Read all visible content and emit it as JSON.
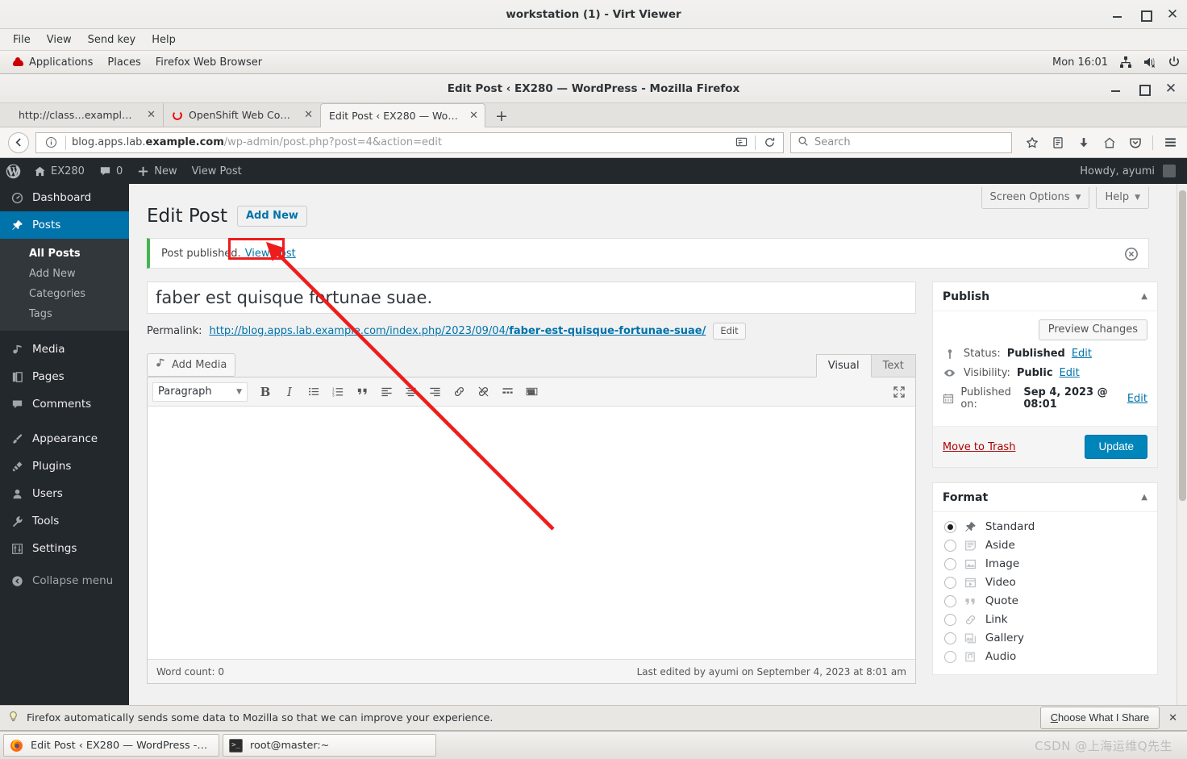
{
  "virt_viewer": {
    "title": "workstation (1) - Virt Viewer",
    "menus": [
      "File",
      "View",
      "Send key",
      "Help"
    ],
    "window_buttons": [
      "minimize",
      "maximize",
      "close"
    ]
  },
  "gnome_panel": {
    "applications": "Applications",
    "places": "Places",
    "app_name": "Firefox Web Browser",
    "clock": "Mon 16:01",
    "tray": [
      "network-icon",
      "volume-muted-icon",
      "power-icon"
    ]
  },
  "firefox": {
    "window_title": "Edit Post ‹ EX280 — WordPress - Mozilla Firefox",
    "tabs": [
      {
        "label": "http://class…example.com/",
        "active": false,
        "favicon": "none"
      },
      {
        "label": "OpenShift Web Cons…",
        "active": false,
        "favicon": "openshift-icon"
      },
      {
        "label": "Edit Post ‹ EX280 — Wor…",
        "active": true,
        "favicon": "none"
      }
    ],
    "new_tab_label": "+",
    "url": {
      "prefix": "blog.apps.lab.",
      "domain": "example.com",
      "path": "/wp-admin/post.php?post=4&action=edit"
    },
    "search_placeholder": "Search",
    "toolbar_icons": [
      "reader-mode-icon",
      "reload-icon",
      "bookmark-star-icon",
      "library-icon",
      "downloads-icon",
      "home-icon",
      "pocket-icon",
      "hamburger-menu-icon"
    ],
    "notification": {
      "text": "Firefox automatically sends some data to Mozilla so that we can improve your experience.",
      "button": "Choose What I Share",
      "close": "✕"
    }
  },
  "wp_adminbar": {
    "site_name": "EX280",
    "comments_count": "0",
    "new_label": "New",
    "view_post_label": "View Post",
    "howdy": "Howdy, ayumi"
  },
  "sidebar": {
    "items": [
      {
        "label": "Dashboard",
        "icon": "dashboard-icon",
        "current": false
      },
      {
        "label": "Posts",
        "icon": "pin-icon",
        "current": true
      },
      {
        "label": "Media",
        "icon": "media-icon",
        "current": false
      },
      {
        "label": "Pages",
        "icon": "pages-icon",
        "current": false
      },
      {
        "label": "Comments",
        "icon": "comments-icon",
        "current": false
      },
      {
        "label": "Appearance",
        "icon": "brush-icon",
        "current": false
      },
      {
        "label": "Plugins",
        "icon": "plugin-icon",
        "current": false
      },
      {
        "label": "Users",
        "icon": "user-icon",
        "current": false
      },
      {
        "label": "Tools",
        "icon": "wrench-icon",
        "current": false
      },
      {
        "label": "Settings",
        "icon": "settings-icon",
        "current": false
      }
    ],
    "submenu": [
      {
        "label": "All Posts",
        "active": true
      },
      {
        "label": "Add New",
        "active": false
      },
      {
        "label": "Categories",
        "active": false
      },
      {
        "label": "Tags",
        "active": false
      }
    ],
    "collapse_label": "Collapse menu"
  },
  "screen_meta": {
    "screen_options": "Screen Options",
    "help": "Help"
  },
  "page": {
    "title": "Edit Post",
    "add_new": "Add New",
    "notice_text": "Post published.",
    "notice_link": "View post"
  },
  "editor": {
    "post_title": "faber est quisque fortunae suae.",
    "permalink_label": "Permalink:",
    "permalink_prefix": "http://blog.apps.lab.example.com/index.php/2023/09/04/",
    "permalink_slug": "faber-est-quisque-fortunae-suae/",
    "permalink_edit": "Edit",
    "add_media": "Add Media",
    "tabs": [
      {
        "label": "Visual",
        "active": true
      },
      {
        "label": "Text",
        "active": false
      }
    ],
    "format_select": "Paragraph",
    "toolbar_buttons": [
      "bold-icon",
      "italic-icon",
      "bulleted-list-icon",
      "numbered-list-icon",
      "blockquote-icon",
      "align-left-icon",
      "align-center-icon",
      "align-right-icon",
      "insert-link-icon",
      "remove-link-icon",
      "read-more-icon",
      "toolbar-toggle-icon"
    ],
    "fullscreen_icon": "fullscreen-icon",
    "content": "",
    "word_count": "Word count: 0",
    "last_edited": "Last edited by ayumi on September 4, 2023 at 8:01 am"
  },
  "publish_box": {
    "title": "Publish",
    "preview_changes": "Preview Changes",
    "status_label": "Status:",
    "status_value": "Published",
    "status_edit": "Edit",
    "visibility_label": "Visibility:",
    "visibility_value": "Public",
    "visibility_edit": "Edit",
    "published_label": "Published on:",
    "published_value": "Sep 4, 2023 @ 08:01",
    "published_edit": "Edit",
    "move_to_trash": "Move to Trash",
    "update": "Update"
  },
  "format_box": {
    "title": "Format",
    "options": [
      {
        "label": "Standard",
        "selected": true,
        "icon": "pin-icon"
      },
      {
        "label": "Aside",
        "selected": false,
        "icon": "aside-icon"
      },
      {
        "label": "Image",
        "selected": false,
        "icon": "image-icon"
      },
      {
        "label": "Video",
        "selected": false,
        "icon": "video-icon"
      },
      {
        "label": "Quote",
        "selected": false,
        "icon": "quote-icon"
      },
      {
        "label": "Link",
        "selected": false,
        "icon": "link-icon"
      },
      {
        "label": "Gallery",
        "selected": false,
        "icon": "gallery-icon"
      },
      {
        "label": "Audio",
        "selected": false,
        "icon": "audio-icon"
      }
    ]
  },
  "taskbar": {
    "windows": [
      {
        "label": "Edit Post ‹ EX280 — WordPress - ...",
        "icon": "firefox-icon"
      },
      {
        "label": "root@master:~",
        "icon": "terminal-icon"
      }
    ],
    "watermark": "CSDN @上海运维Q先生"
  },
  "colors": {
    "wp_blue": "#0073aa",
    "wp_dark": "#23282d",
    "notice_green": "#46b450",
    "trash_red": "#a00000",
    "annotation_red": "#ee1c1c"
  }
}
